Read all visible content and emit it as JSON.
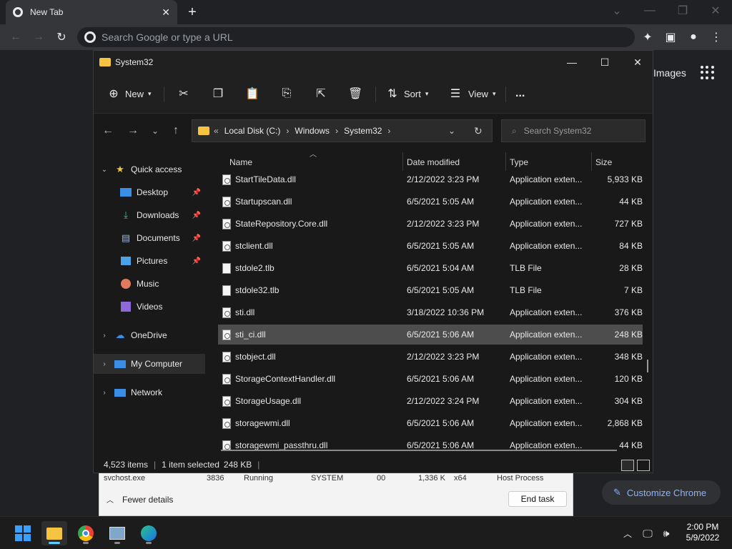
{
  "chrome": {
    "tab_title": "New Tab",
    "omnibox_placeholder": "Search Google or type a URL",
    "images_link": "Images",
    "customize_label": "Customize Chrome"
  },
  "explorer": {
    "window_title": "System32",
    "toolbar": {
      "new_label": "New",
      "sort_label": "Sort",
      "view_label": "View",
      "more_label": "..."
    },
    "breadcrumb": {
      "overflow": "«",
      "items": [
        "Local Disk (C:)",
        "Windows",
        "System32"
      ]
    },
    "search_placeholder": "Search System32",
    "nav": {
      "quick_access": "Quick access",
      "desktop": "Desktop",
      "downloads": "Downloads",
      "documents": "Documents",
      "pictures": "Pictures",
      "music": "Music",
      "videos": "Videos",
      "onedrive": "OneDrive",
      "my_computer": "My Computer",
      "network": "Network"
    },
    "columns": {
      "name": "Name",
      "date": "Date modified",
      "type": "Type",
      "size": "Size"
    },
    "files": [
      {
        "name": "StartTileData.dll",
        "date": "2/12/2022 3:23 PM",
        "type": "Application exten...",
        "size": "5,933 KB"
      },
      {
        "name": "Startupscan.dll",
        "date": "6/5/2021 5:05 AM",
        "type": "Application exten...",
        "size": "44 KB"
      },
      {
        "name": "StateRepository.Core.dll",
        "date": "2/12/2022 3:23 PM",
        "type": "Application exten...",
        "size": "727 KB"
      },
      {
        "name": "stclient.dll",
        "date": "6/5/2021 5:05 AM",
        "type": "Application exten...",
        "size": "84 KB"
      },
      {
        "name": "stdole2.tlb",
        "date": "6/5/2021 5:04 AM",
        "type": "TLB File",
        "size": "28 KB"
      },
      {
        "name": "stdole32.tlb",
        "date": "6/5/2021 5:05 AM",
        "type": "TLB File",
        "size": "7 KB"
      },
      {
        "name": "sti.dll",
        "date": "3/18/2022 10:36 PM",
        "type": "Application exten...",
        "size": "376 KB"
      },
      {
        "name": "sti_ci.dll",
        "date": "6/5/2021 5:06 AM",
        "type": "Application exten...",
        "size": "248 KB"
      },
      {
        "name": "stobject.dll",
        "date": "2/12/2022 3:23 PM",
        "type": "Application exten...",
        "size": "348 KB"
      },
      {
        "name": "StorageContextHandler.dll",
        "date": "6/5/2021 5:06 AM",
        "type": "Application exten...",
        "size": "120 KB"
      },
      {
        "name": "StorageUsage.dll",
        "date": "2/12/2022 3:24 PM",
        "type": "Application exten...",
        "size": "304 KB"
      },
      {
        "name": "storagewmi.dll",
        "date": "6/5/2021 5:06 AM",
        "type": "Application exten...",
        "size": "2,868 KB"
      },
      {
        "name": "storagewmi_passthru.dll",
        "date": "6/5/2021 5:06 AM",
        "type": "Application exten...",
        "size": "44 KB"
      }
    ],
    "status": {
      "item_count": "4,523 items",
      "selected": "1 item selected",
      "selected_size": "248 KB"
    }
  },
  "taskmgr": {
    "row": {
      "name": "svchost.exe",
      "pid": "3836",
      "status": "Running",
      "user": "SYSTEM",
      "cpu": "00",
      "mem": "1,336 K",
      "arch": "x64",
      "desc": "Host Process"
    },
    "fewer_details": "Fewer details",
    "end_task": "End task"
  },
  "taskbar": {
    "time": "2:00 PM",
    "date": "5/9/2022"
  },
  "colors": {
    "selection": "#4d4d4d",
    "accent": "#60cdff",
    "folder": "#f5c542"
  }
}
